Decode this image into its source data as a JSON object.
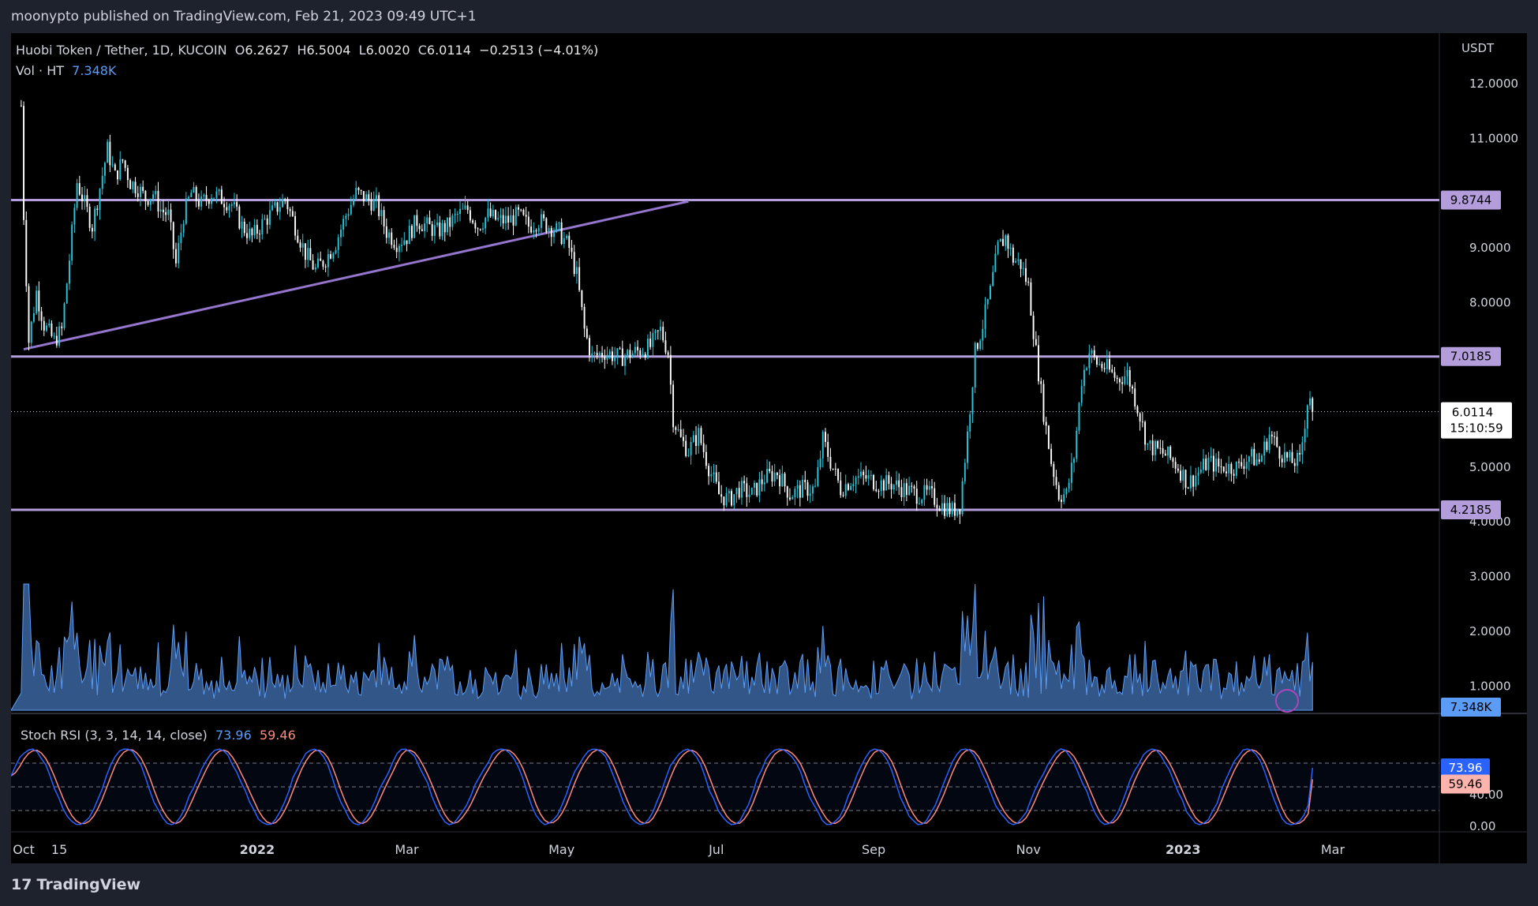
{
  "header": {
    "published": "moonypto published on TradingView.com, Feb 21, 2023 09:49 UTC+1"
  },
  "footer": {
    "brand": "TradingView"
  },
  "legend": {
    "symbol": "Huobi Token / Tether, 1D, KUCOIN",
    "open_label": "O",
    "open": "6.2627",
    "high_label": "H",
    "high": "6.5004",
    "low_label": "L",
    "low": "6.0020",
    "close_label": "C",
    "close": "6.0114",
    "change": "−0.2513 (−4.01%)",
    "vol_label": "Vol · HT",
    "vol_value": "7.348K",
    "stoch_label": "Stoch RSI (3, 3, 14, 14, close)",
    "stoch_k": "73.96",
    "stoch_d": "59.46"
  },
  "colors": {
    "up": "#26c6da",
    "down": "#ffffff",
    "level": "#b39ddb",
    "trend": "#9575cd",
    "volume": "#5b9cf6",
    "k_line": "#2962ff",
    "d_line": "#ff8a80"
  },
  "chart_data": [
    {
      "type": "candlestick",
      "currency": "USDT",
      "y_ticks": [
        "12.0000",
        "11.0000",
        "9.0000",
        "8.0000",
        "5.0000",
        "4.0000",
        "3.0000",
        "2.0000",
        "1.0000"
      ],
      "ylim": [
        0.3,
        12.3
      ],
      "x_ticks": [
        "Oct",
        "15",
        "2022",
        "Mar",
        "May",
        "Jul",
        "Sep",
        "Nov",
        "2023",
        "Mar"
      ],
      "x_tick_dates": [
        "2021-10-01",
        "2021-10-15",
        "2022-01-01",
        "2022-03-01",
        "2022-05-01",
        "2022-07-01",
        "2022-09-01",
        "2022-11-01",
        "2023-01-01",
        "2023-03-01"
      ],
      "horizontal_levels": [
        {
          "value": 9.8744,
          "label": "9.8744"
        },
        {
          "value": 7.0185,
          "label": "7.0185"
        },
        {
          "value": 4.2185,
          "label": "4.2185"
        }
      ],
      "trendline": [
        {
          "date": "2021-10-01",
          "value": 7.15
        },
        {
          "date": "2022-06-20",
          "value": 9.85
        }
      ],
      "last_price": {
        "value": 6.0114,
        "label": "6.0114",
        "countdown": "15:10:59"
      },
      "volume_label": "7.348K",
      "close_series": [
        [
          "2021-09-30",
          11.6
        ],
        [
          "2021-10-01",
          9.6
        ],
        [
          "2021-10-03",
          7.3
        ],
        [
          "2021-10-06",
          8.2
        ],
        [
          "2021-10-09",
          7.6
        ],
        [
          "2021-10-13",
          7.3
        ],
        [
          "2021-10-16",
          7.5
        ],
        [
          "2021-10-19",
          8.8
        ],
        [
          "2021-10-22",
          10.2
        ],
        [
          "2021-10-25",
          9.8
        ],
        [
          "2021-10-28",
          9.4
        ],
        [
          "2021-10-31",
          10.1
        ],
        [
          "2021-11-03",
          10.8
        ],
        [
          "2021-11-06",
          10.3
        ],
        [
          "2021-11-09",
          10.6
        ],
        [
          "2021-11-12",
          10.2
        ],
        [
          "2021-11-15",
          10.1
        ],
        [
          "2021-11-18",
          9.9
        ],
        [
          "2021-11-21",
          10.0
        ],
        [
          "2021-11-24",
          9.7
        ],
        [
          "2021-11-27",
          9.6
        ],
        [
          "2021-11-30",
          8.7
        ],
        [
          "2021-12-03",
          9.6
        ],
        [
          "2021-12-06",
          10.0
        ],
        [
          "2021-12-10",
          9.8
        ],
        [
          "2021-12-14",
          10.0
        ],
        [
          "2021-12-18",
          9.9
        ],
        [
          "2021-12-22",
          9.8
        ],
        [
          "2021-12-26",
          9.4
        ],
        [
          "2021-12-30",
          9.2
        ],
        [
          "2022-01-04",
          9.5
        ],
        [
          "2022-01-08",
          9.7
        ],
        [
          "2022-01-12",
          9.9
        ],
        [
          "2022-01-16",
          9.4
        ],
        [
          "2022-01-20",
          8.9
        ],
        [
          "2022-01-24",
          8.6
        ],
        [
          "2022-01-28",
          8.8
        ],
        [
          "2022-02-01",
          9.1
        ],
        [
          "2022-02-05",
          9.6
        ],
        [
          "2022-02-09",
          10.0
        ],
        [
          "2022-02-13",
          9.9
        ],
        [
          "2022-02-17",
          9.8
        ],
        [
          "2022-02-21",
          9.3
        ],
        [
          "2022-02-25",
          9.1
        ],
        [
          "2022-03-01",
          9.2
        ],
        [
          "2022-03-05",
          9.5
        ],
        [
          "2022-03-09",
          9.4
        ],
        [
          "2022-03-13",
          9.3
        ],
        [
          "2022-03-17",
          9.4
        ],
        [
          "2022-03-21",
          9.6
        ],
        [
          "2022-03-25",
          9.7
        ],
        [
          "2022-03-29",
          9.4
        ],
        [
          "2022-04-02",
          9.6
        ],
        [
          "2022-04-06",
          9.5
        ],
        [
          "2022-04-10",
          9.5
        ],
        [
          "2022-04-14",
          9.6
        ],
        [
          "2022-04-18",
          9.4
        ],
        [
          "2022-04-22",
          9.5
        ],
        [
          "2022-04-26",
          9.4
        ],
        [
          "2022-04-30",
          9.3
        ],
        [
          "2022-05-04",
          9.0
        ],
        [
          "2022-05-07",
          8.5
        ],
        [
          "2022-05-10",
          7.5
        ],
        [
          "2022-05-13",
          7.0
        ],
        [
          "2022-05-18",
          7.1
        ],
        [
          "2022-05-24",
          7.0
        ],
        [
          "2022-05-30",
          7.1
        ],
        [
          "2022-06-05",
          7.2
        ],
        [
          "2022-06-09",
          7.5
        ],
        [
          "2022-06-12",
          7.1
        ],
        [
          "2022-06-14",
          5.9
        ],
        [
          "2022-06-17",
          5.5
        ],
        [
          "2022-06-20",
          5.3
        ],
        [
          "2022-06-24",
          5.6
        ],
        [
          "2022-06-28",
          5.0
        ],
        [
          "2022-07-02",
          4.5
        ],
        [
          "2022-07-06",
          4.4
        ],
        [
          "2022-07-10",
          4.6
        ],
        [
          "2022-07-15",
          4.5
        ],
        [
          "2022-07-20",
          4.8
        ],
        [
          "2022-07-25",
          4.9
        ],
        [
          "2022-07-30",
          4.5
        ],
        [
          "2022-08-04",
          4.6
        ],
        [
          "2022-08-09",
          4.6
        ],
        [
          "2022-08-12",
          5.5
        ],
        [
          "2022-08-15",
          5.1
        ],
        [
          "2022-08-19",
          4.6
        ],
        [
          "2022-08-24",
          4.8
        ],
        [
          "2022-08-29",
          4.8
        ],
        [
          "2022-09-03",
          4.7
        ],
        [
          "2022-09-08",
          4.7
        ],
        [
          "2022-09-13",
          4.6
        ],
        [
          "2022-09-18",
          4.5
        ],
        [
          "2022-09-23",
          4.5
        ],
        [
          "2022-09-28",
          4.3
        ],
        [
          "2022-10-02",
          4.2
        ],
        [
          "2022-10-05",
          4.3
        ],
        [
          "2022-10-08",
          5.6
        ],
        [
          "2022-10-11",
          7.1
        ],
        [
          "2022-10-14",
          7.6
        ],
        [
          "2022-10-17",
          8.2
        ],
        [
          "2022-10-20",
          9.0
        ],
        [
          "2022-10-23",
          9.2
        ],
        [
          "2022-10-26",
          8.8
        ],
        [
          "2022-10-29",
          8.7
        ],
        [
          "2022-11-01",
          8.3
        ],
        [
          "2022-11-04",
          7.1
        ],
        [
          "2022-11-07",
          6.0
        ],
        [
          "2022-11-10",
          5.1
        ],
        [
          "2022-11-13",
          4.5
        ],
        [
          "2022-11-16",
          4.5
        ],
        [
          "2022-11-19",
          5.2
        ],
        [
          "2022-11-22",
          6.6
        ],
        [
          "2022-11-25",
          7.1
        ],
        [
          "2022-11-28",
          6.9
        ],
        [
          "2022-12-02",
          6.8
        ],
        [
          "2022-12-06",
          6.6
        ],
        [
          "2022-12-10",
          6.7
        ],
        [
          "2022-12-14",
          6.1
        ],
        [
          "2022-12-18",
          5.4
        ],
        [
          "2022-12-22",
          5.3
        ],
        [
          "2022-12-26",
          5.2
        ],
        [
          "2022-12-30",
          5.0
        ],
        [
          "2023-01-03",
          4.7
        ],
        [
          "2023-01-07",
          4.9
        ],
        [
          "2023-01-11",
          5.1
        ],
        [
          "2023-01-15",
          5.0
        ],
        [
          "2023-01-19",
          5.0
        ],
        [
          "2023-01-23",
          5.0
        ],
        [
          "2023-01-27",
          5.2
        ],
        [
          "2023-01-31",
          5.1
        ],
        [
          "2023-02-04",
          5.6
        ],
        [
          "2023-02-08",
          5.3
        ],
        [
          "2023-02-12",
          5.1
        ],
        [
          "2023-02-16",
          5.1
        ],
        [
          "2023-02-19",
          6.2
        ],
        [
          "2023-02-20",
          6.3
        ],
        [
          "2023-02-21",
          6.0114
        ]
      ]
    },
    {
      "type": "line",
      "title": "Stoch RSI (3, 3, 14, 14, close)",
      "y_ticks": [
        "0.00",
        "40.00"
      ],
      "band": [
        20,
        80
      ],
      "mid": 50,
      "ylim": [
        0,
        100
      ],
      "series": [
        {
          "name": "K",
          "last": 73.96
        },
        {
          "name": "D",
          "last": 59.46
        }
      ]
    }
  ]
}
